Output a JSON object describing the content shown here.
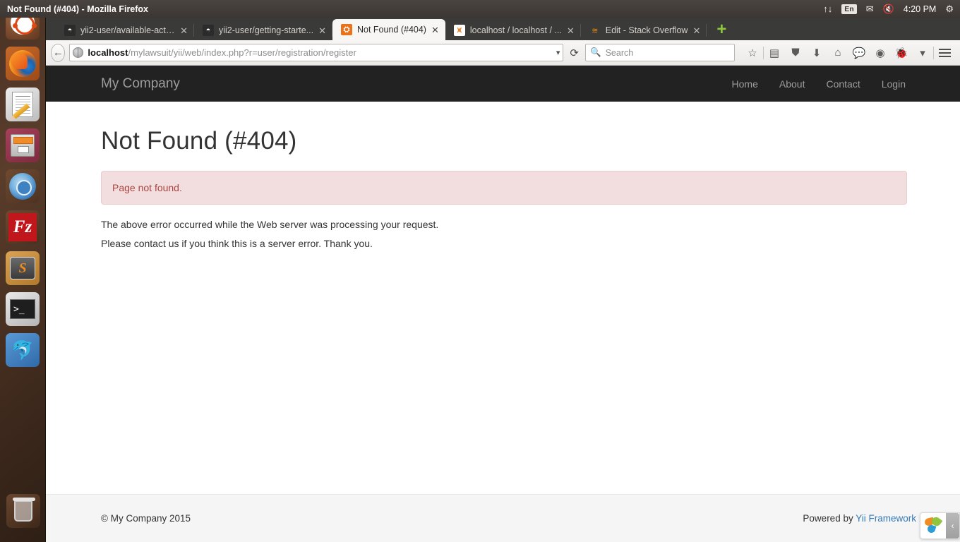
{
  "panel": {
    "window_title": "Not Found (#404) - Mozilla Firefox",
    "tray": {
      "network_icon": "↑↓",
      "keyboard_layout": "En",
      "mail_icon": "✉",
      "volume_icon": "🔇",
      "clock": "4:20 PM",
      "settings_icon": "⚙"
    }
  },
  "launcher": {
    "items": [
      {
        "name": "ubuntu-dash",
        "label": "Ubuntu Dash"
      },
      {
        "name": "firefox",
        "label": "Firefox Web Browser"
      },
      {
        "name": "text-editor",
        "label": "Text Editor"
      },
      {
        "name": "file-manager",
        "label": "Files"
      },
      {
        "name": "chromium",
        "label": "Chromium Web Browser"
      },
      {
        "name": "filezilla",
        "label": "FileZilla",
        "glyph": "Fz"
      },
      {
        "name": "sublime-text",
        "label": "Sublime Text",
        "glyph": "S"
      },
      {
        "name": "terminal",
        "label": "Terminal",
        "glyph": ">_"
      },
      {
        "name": "mysql-workbench",
        "label": "MySQL Workbench",
        "glyph": "🐬"
      },
      {
        "name": "trash",
        "label": "Trash"
      }
    ]
  },
  "browser": {
    "tabs": [
      {
        "title": "yii2-user/available-actio...",
        "favicon": "github-icon",
        "active": false
      },
      {
        "title": "yii2-user/getting-starte...",
        "favicon": "github-icon",
        "active": false
      },
      {
        "title": "Not Found (#404)",
        "favicon": "yii-icon",
        "active": true
      },
      {
        "title": "localhost / localhost / ...",
        "favicon": "phpmyadmin-icon",
        "active": false
      },
      {
        "title": "Edit - Stack Overflow",
        "favicon": "stackoverflow-icon",
        "active": false
      }
    ],
    "new_tab_label": "+",
    "close_label": "✕",
    "url": {
      "host": "localhost",
      "path": "/mylawsuit/yii/web/index.php?r=user/registration/register"
    },
    "search_placeholder": "Search",
    "back_icon": "←",
    "reload_icon": "⟳",
    "dropdown_icon": "▾",
    "toolbar_icons": [
      {
        "name": "bookmark-star-icon",
        "glyph": "☆"
      },
      {
        "name": "reader-mode-icon",
        "glyph": "▤"
      },
      {
        "name": "pocket-icon",
        "glyph": "⛊"
      },
      {
        "name": "downloads-icon",
        "glyph": "⬇"
      },
      {
        "name": "home-icon",
        "glyph": "⌂"
      },
      {
        "name": "chat-icon",
        "glyph": "💬"
      },
      {
        "name": "colorzilla-icon",
        "glyph": "◉"
      },
      {
        "name": "firebug-icon",
        "glyph": "🐞"
      },
      {
        "name": "overflow-chevron-icon",
        "glyph": "▾"
      }
    ]
  },
  "site": {
    "brand": "My Company",
    "nav": [
      {
        "label": "Home"
      },
      {
        "label": "About"
      },
      {
        "label": "Contact"
      },
      {
        "label": "Login"
      }
    ],
    "error_title": "Not Found (#404)",
    "alert_message": "Page not found.",
    "paragraph_1": "The above error occurred while the Web server was processing your request.",
    "paragraph_2": "Please contact us if you think this is a server error. Thank you.",
    "footer": {
      "copyright": "© My Company 2015",
      "powered_by_prefix": "Powered by ",
      "powered_by_link": "Yii Framework"
    },
    "debug_toolbar": {
      "collapse_icon": "‹"
    }
  },
  "colors": {
    "navbar_bg": "#222222",
    "alert_bg": "#f2dede",
    "alert_text": "#a94442",
    "link": "#337ab7",
    "footer_bg": "#f5f5f5",
    "launcher_bg": "#3f2a1d"
  }
}
